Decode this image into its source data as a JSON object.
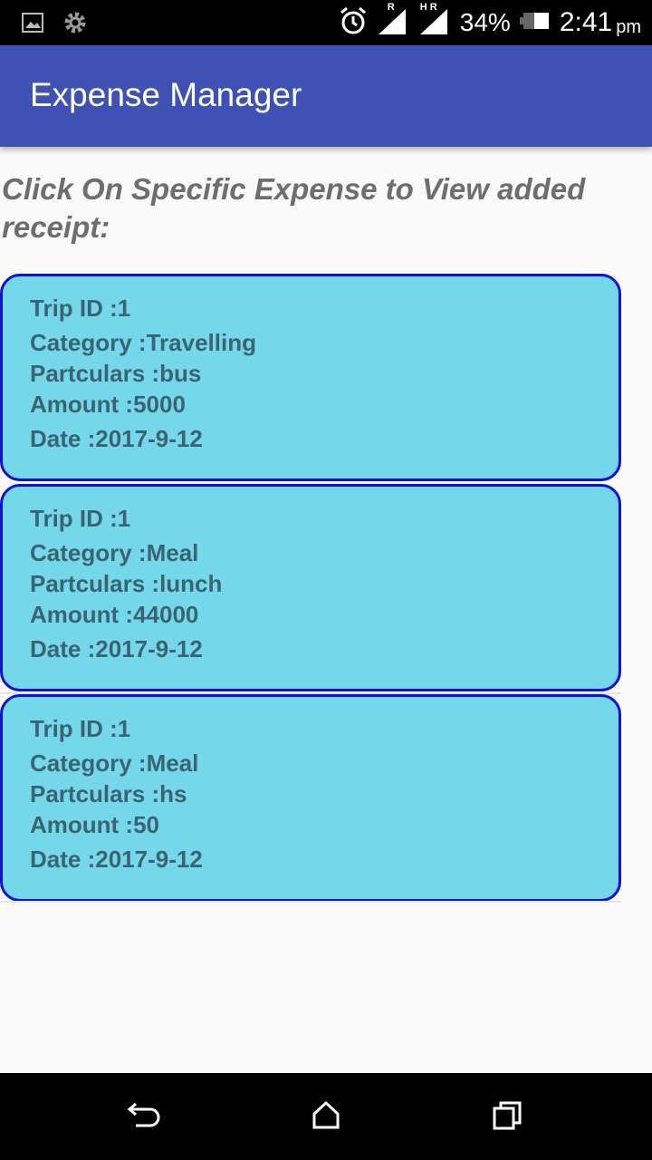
{
  "status_bar": {
    "signal_1_label": "R",
    "signal_2_label": "H R",
    "battery_percent": "34%",
    "time": "2:41",
    "ampm": "pm"
  },
  "app_bar": {
    "title": "Expense Manager"
  },
  "instruction": "Click On Specific Expense to View added receipt:",
  "expenses": [
    {
      "trip_id": "Trip ID :1",
      "category": "Category :Travelling",
      "particulars": "Partculars :bus",
      "amount": "Amount :5000",
      "date": "Date :2017-9-12"
    },
    {
      "trip_id": "Trip ID :1",
      "category": "Category :Meal",
      "particulars": "Partculars :lunch",
      "amount": "Amount :44000",
      "date": "Date :2017-9-12"
    },
    {
      "trip_id": "Trip ID :1",
      "category": "Category :Meal",
      "particulars": "Partculars :hs",
      "amount": "Amount :50",
      "date": "Date :2017-9-12"
    }
  ],
  "colors": {
    "app_bar": "#3f51b5",
    "card_background": "#74d8ea",
    "card_border": "#1010d8",
    "card_text": "#3b6472",
    "instruction_text": "#6e6e6e"
  },
  "icons": {
    "status_left": [
      "image-notification-icon",
      "settings-notification-icon"
    ],
    "status_right": [
      "alarm-icon",
      "signal-icon",
      "signal-icon",
      "battery-icon"
    ],
    "navigation": [
      "back-icon",
      "home-icon",
      "recents-icon"
    ]
  }
}
